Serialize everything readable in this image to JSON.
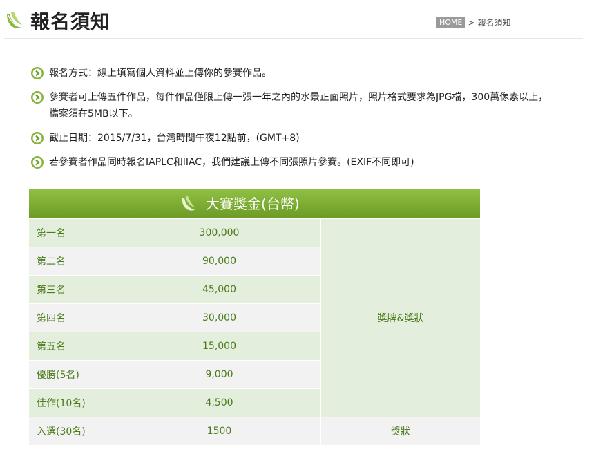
{
  "header": {
    "title": "報名須知",
    "breadcrumb": {
      "home": "HOME",
      "separator": ">",
      "current": "報名須知"
    }
  },
  "notes": [
    {
      "text": "報名方式：線上填寫個人資料並上傳你的參賽作品。"
    },
    {
      "text": "參賽者可上傳五件作品，每件作品僅限上傳一張一年之內的水景正面照片，照片格式要求為JPG檔，300萬像素以上，檔案須在5MB以下。"
    },
    {
      "text": "截止日期：2015/7/31，台灣時間午夜12點前，(GMT+8)"
    },
    {
      "text": "若參賽者作品同時報名IAPLC和IIAC，我們建議上傳不同張照片參賽。(EXIF不同即可)"
    }
  ],
  "prize_table": {
    "title": "大賽獎金(台幣)",
    "rows": [
      {
        "rank": "第一名",
        "amount": "300,000"
      },
      {
        "rank": "第二名",
        "amount": "90,000"
      },
      {
        "rank": "第三名",
        "amount": "45,000"
      },
      {
        "rank": "第四名",
        "amount": "30,000"
      },
      {
        "rank": "第五名",
        "amount": "15,000"
      },
      {
        "rank": "優勝(5名)",
        "amount": "9,000"
      },
      {
        "rank": "佳作(10名)",
        "amount": "4,500"
      },
      {
        "rank": "入選(30名)",
        "amount": "1500"
      }
    ],
    "award_top": "獎牌&獎狀",
    "award_last": "獎狀"
  },
  "colors": {
    "accent_green": "#7aab2f",
    "table_text": "#4a7a1a",
    "row_tint": "#e3efdc",
    "row_alt": "#f2f2f2"
  },
  "icons": {
    "logo": "green-leaf-icon",
    "bullet": "green-arrow-circle-icon"
  }
}
